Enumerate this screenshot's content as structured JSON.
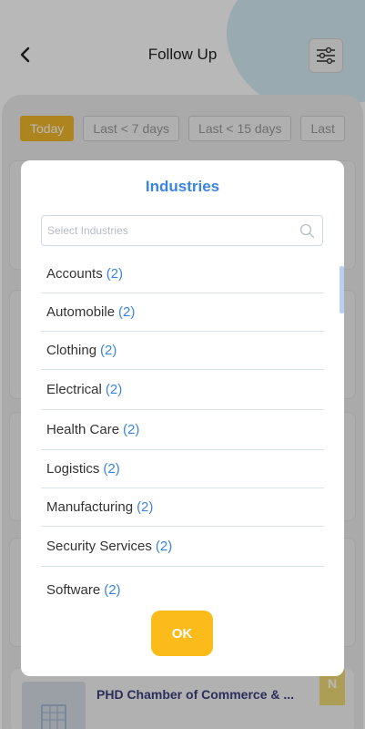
{
  "header": {
    "title": "Follow Up",
    "back_icon": "chevron-left-icon",
    "filter_icon": "sliders-icon"
  },
  "chips": [
    {
      "label": "Today",
      "active": true
    },
    {
      "label": "Last < 7 days",
      "active": false
    },
    {
      "label": "Last < 15 days",
      "active": false
    },
    {
      "label": "Last",
      "active": false
    }
  ],
  "bottom_card": {
    "company": "PHD Chamber of Commerce & ...",
    "badge": "N"
  },
  "modal": {
    "title": "Industries",
    "search": {
      "placeholder": "Select Industries",
      "value": ""
    },
    "items": [
      {
        "label": "Accounts",
        "count": "(2)"
      },
      {
        "label": "Automobile",
        "count": "(2)"
      },
      {
        "label": "Clothing",
        "count": "(2)"
      },
      {
        "label": "Electrical",
        "count": "(2)"
      },
      {
        "label": "Health Care",
        "count": "(2)"
      },
      {
        "label": "Logistics",
        "count": "(2)"
      },
      {
        "label": "Manufacturing",
        "count": "(2)"
      },
      {
        "label": "Security Services",
        "count": "(2)"
      },
      {
        "label": "Software",
        "count": "(2)"
      }
    ],
    "ok_label": "OK"
  },
  "colors": {
    "accent": "#3b84e0",
    "button": "#fbbb1b",
    "chip_active": "#f2b82a"
  }
}
